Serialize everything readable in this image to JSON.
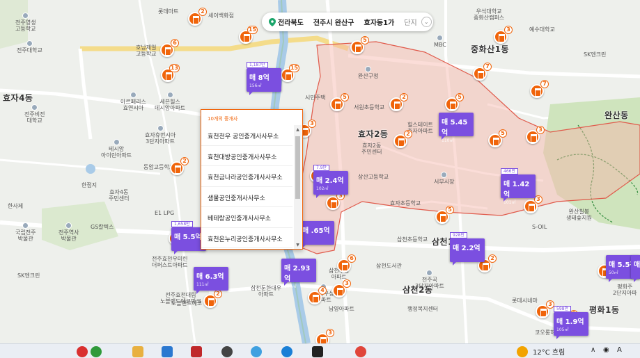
{
  "location_bar": {
    "province": "전라북도",
    "district": "전주시 완산구",
    "dong": "효자동1가",
    "complex": "단지"
  },
  "agent_popup": {
    "header": "10개의 중개사",
    "items": [
      "효천천우 공인중개사사무소",
      "효천대방공인중개사사무소",
      "효천금나라공인중개사사무소",
      "샘물공인중개사사무소",
      "베테랑공인중개사사무소",
      "효천온누리공인중개사사무소"
    ]
  },
  "districts": [
    "효자4동",
    "효자2동",
    "중화산1동",
    "완산동",
    "삼천1동",
    "삼천2동",
    "평화1동",
    "평화"
  ],
  "places": [
    {
      "name": "전주영생\n고등학교"
    },
    {
      "name": "롯데마트"
    },
    {
      "name": "세이백화점"
    },
    {
      "name": "우석대학교\n중화산캠퍼스"
    },
    {
      "name": "예수대학교"
    },
    {
      "name": "전주대학교"
    },
    {
      "name": "호남제일\n고등학교"
    },
    {
      "name": "MBC"
    },
    {
      "name": "SK엔크린"
    },
    {
      "name": "완산구청"
    },
    {
      "name": "전주비전\n대학교"
    },
    {
      "name": "아르페리스\n효연시아"
    },
    {
      "name": "세븐힐스\n데시앙아파트"
    },
    {
      "name": "시민주택"
    },
    {
      "name": "서원초등학교"
    },
    {
      "name": "효자휴먼시아\n3단지아파트"
    },
    {
      "name": "테시앙\n아이린아파트"
    },
    {
      "name": "동암고등학교"
    },
    {
      "name": "힐스테이트\n효자아파트"
    },
    {
      "name": "효자2동\n주민센터"
    },
    {
      "name": "상산고등학교"
    },
    {
      "name": "서부시장"
    },
    {
      "name": "한점지"
    },
    {
      "name": "효자4동\n주민센터"
    },
    {
      "name": "효자초등학교"
    },
    {
      "name": "한사제"
    },
    {
      "name": "E1 LPG"
    },
    {
      "name": "국립전주\n박물관"
    },
    {
      "name": "전주역사\n박물관"
    },
    {
      "name": "GS칼텍스"
    },
    {
      "name": "S-OIL"
    },
    {
      "name": "완산칠봉\n생태숲지원"
    },
    {
      "name": "SK엔크린"
    },
    {
      "name": "전주효천우미린\n더퍼스트아파트"
    },
    {
      "name": "삼천초등학교"
    },
    {
      "name": "삼천도서관"
    },
    {
      "name": "전주곡\n3단지아파트"
    },
    {
      "name": "삼천주공\n아파트"
    },
    {
      "name": "삼천우성\n아파트"
    },
    {
      "name": "롯데시네마"
    },
    {
      "name": "남양아파트"
    },
    {
      "name": "노블랜드에코"
    },
    {
      "name": "코오롱하늘채"
    },
    {
      "name": "행정복지센터"
    },
    {
      "name": "전주효천대림\n노블랜드에코파크"
    },
    {
      "name": "평화주\n2단지아파"
    },
    {
      "name": "삼천둔한대우\n아파트"
    }
  ],
  "broker_markers": [
    {
      "count": "2"
    },
    {
      "count": "15"
    },
    {
      "count": "6"
    },
    {
      "count": "13"
    },
    {
      "count": "15"
    },
    {
      "count": "3"
    },
    {
      "count": "5"
    },
    {
      "count": "5"
    },
    {
      "count": "2"
    },
    {
      "count": "3"
    },
    {
      "count": "7"
    },
    {
      "count": "7"
    },
    {
      "count": "5"
    },
    {
      "count": "2"
    },
    {
      "count": "3"
    },
    {
      "count": "5"
    },
    {
      "count": "2"
    },
    {
      "count": "3"
    },
    {
      "count": "3"
    },
    {
      "count": "2"
    },
    {
      "count": "5"
    },
    {
      "count": "2"
    },
    {
      "count": "2"
    },
    {
      "count": "6"
    },
    {
      "count": "4"
    },
    {
      "count": "3"
    },
    {
      "count": "2"
    },
    {
      "count": "2"
    },
    {
      "count": "3"
    },
    {
      "count": "2"
    },
    {
      "count": "3"
    }
  ],
  "price_markers": [
    {
      "top": "1,187만",
      "price": "매 8억",
      "size": "156㎡"
    },
    {
      "top": "",
      "price": "매 5.45억",
      "size": "110㎡"
    },
    {
      "top": "7.9만",
      "price": "매 2.4억",
      "size": "102㎡"
    },
    {
      "top": "466만",
      "price": "매 1.42억",
      "size": "101㎡"
    },
    {
      "top": "1,658만",
      "price": "매 5.5억",
      "size": ""
    },
    {
      "top": "",
      "price": "매 6.3억",
      "size": "111㎡"
    },
    {
      "top": "",
      "price": "매 .65억",
      "size": ""
    },
    {
      "top": "",
      "price": "매 2.93억",
      "size": "110㎡"
    },
    {
      "top": "928만",
      "price": "매 2.2억",
      "size": ""
    },
    {
      "top": "598만",
      "price": "매 1.9억",
      "size": "105㎡"
    },
    {
      "top": "",
      "price": "매 5.5천",
      "size": "50㎡"
    },
    {
      "top": "",
      "price": "매",
      "size": ""
    }
  ],
  "taskbar": {
    "weather": "12°C 흐림"
  }
}
